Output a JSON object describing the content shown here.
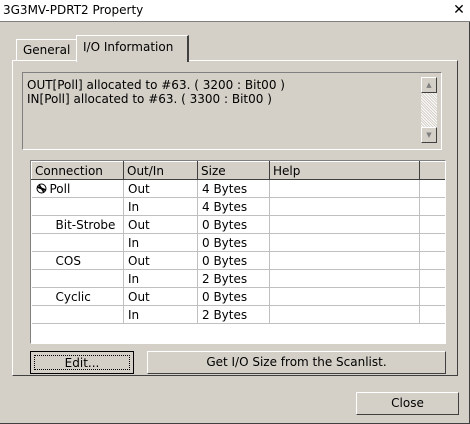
{
  "window": {
    "title": "3G3MV-PDRT2 Property",
    "close_glyph": "✕"
  },
  "tabs": [
    {
      "label": "General"
    },
    {
      "label": "I/O Information"
    }
  ],
  "info": {
    "lines": [
      "OUT[Poll] allocated to #63. ( 3200 : Bit00 )",
      "IN[Poll] allocated to #63. ( 3300 : Bit00 )"
    ]
  },
  "table": {
    "headers": [
      "Connection",
      "Out/In",
      "Size",
      "Help"
    ],
    "rows": [
      {
        "connection": "Poll",
        "outin": "Out",
        "size": "4 Bytes",
        "help": ""
      },
      {
        "connection": "",
        "outin": "In",
        "size": "4 Bytes",
        "help": ""
      },
      {
        "connection": "Bit-Strobe",
        "outin": "Out",
        "size": "0 Bytes",
        "help": ""
      },
      {
        "connection": "",
        "outin": "In",
        "size": "0 Bytes",
        "help": ""
      },
      {
        "connection": "COS",
        "outin": "Out",
        "size": "0 Bytes",
        "help": ""
      },
      {
        "connection": "",
        "outin": "In",
        "size": "2 Bytes",
        "help": ""
      },
      {
        "connection": "Cyclic",
        "outin": "Out",
        "size": "0 Bytes",
        "help": ""
      },
      {
        "connection": "",
        "outin": "In",
        "size": "2 Bytes",
        "help": ""
      }
    ]
  },
  "buttons": {
    "edit": "Edit...",
    "get_size": "Get I/O Size from the Scanlist.",
    "close": "Close"
  }
}
